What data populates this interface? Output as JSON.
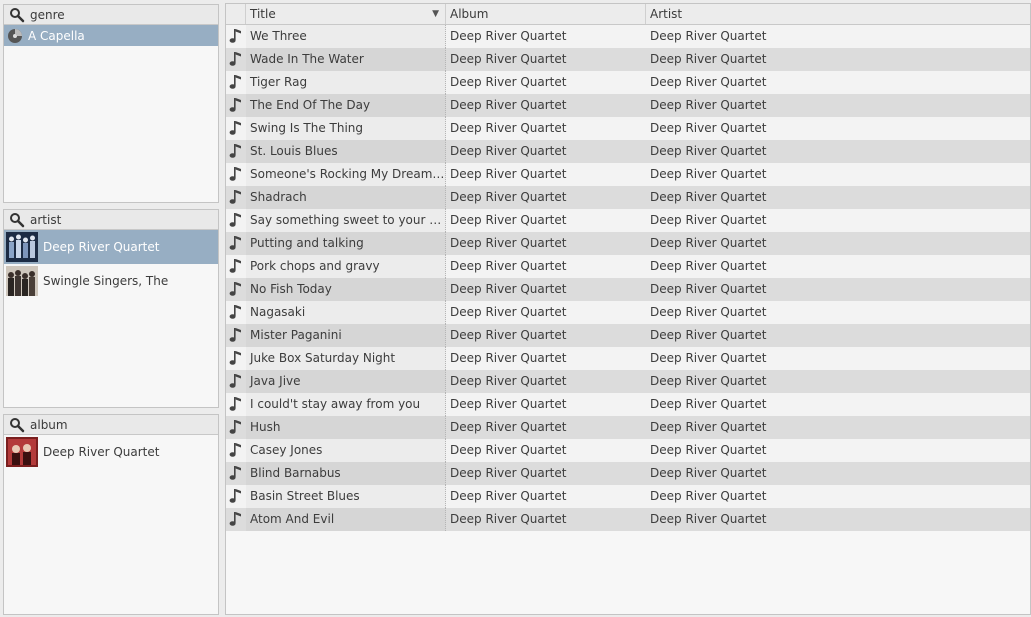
{
  "genre_pane": {
    "title": "genre",
    "items": [
      {
        "label": "A Capella",
        "selected": true
      }
    ]
  },
  "artist_pane": {
    "title": "artist",
    "items": [
      {
        "label": "Deep River Quartet",
        "selected": true
      },
      {
        "label": "Swingle Singers, The",
        "selected": false
      }
    ]
  },
  "album_pane": {
    "title": "album",
    "items": [
      {
        "label": "Deep River Quartet",
        "selected": false
      }
    ]
  },
  "tracklist": {
    "columns": {
      "title": "Title",
      "album": "Album",
      "artist": "Artist"
    },
    "sort_indicator": "▼",
    "tracks": [
      {
        "title": "We Three",
        "album": "Deep River Quartet",
        "artist": "Deep River Quartet"
      },
      {
        "title": "Wade In The Water",
        "album": "Deep River Quartet",
        "artist": "Deep River Quartet"
      },
      {
        "title": "Tiger Rag",
        "album": "Deep River Quartet",
        "artist": "Deep River Quartet"
      },
      {
        "title": "The End Of The Day",
        "album": "Deep River Quartet",
        "artist": "Deep River Quartet"
      },
      {
        "title": "Swing Is The Thing",
        "album": "Deep River Quartet",
        "artist": "Deep River Quartet"
      },
      {
        "title": "St. Louis Blues",
        "album": "Deep River Quartet",
        "artist": "Deep River Quartet"
      },
      {
        "title": "Someone's Rocking My Dreamboat",
        "album": "Deep River Quartet",
        "artist": "Deep River Quartet"
      },
      {
        "title": "Shadrach",
        "album": "Deep River Quartet",
        "artist": "Deep River Quartet"
      },
      {
        "title": "Say something sweet to your sweetheart",
        "album": "Deep River Quartet",
        "artist": "Deep River Quartet"
      },
      {
        "title": "Putting and talking",
        "album": "Deep River Quartet",
        "artist": "Deep River Quartet"
      },
      {
        "title": "Pork chops and gravy",
        "album": "Deep River Quartet",
        "artist": "Deep River Quartet"
      },
      {
        "title": "No Fish Today",
        "album": "Deep River Quartet",
        "artist": "Deep River Quartet"
      },
      {
        "title": "Nagasaki",
        "album": "Deep River Quartet",
        "artist": "Deep River Quartet"
      },
      {
        "title": "Mister Paganini",
        "album": "Deep River Quartet",
        "artist": "Deep River Quartet"
      },
      {
        "title": "Juke Box Saturday Night",
        "album": "Deep River Quartet",
        "artist": "Deep River Quartet"
      },
      {
        "title": "Java Jive",
        "album": "Deep River Quartet",
        "artist": "Deep River Quartet"
      },
      {
        "title": "I could't stay away from you",
        "album": "Deep River Quartet",
        "artist": "Deep River Quartet"
      },
      {
        "title": "Hush",
        "album": "Deep River Quartet",
        "artist": "Deep River Quartet"
      },
      {
        "title": "Casey Jones",
        "album": "Deep River Quartet",
        "artist": "Deep River Quartet"
      },
      {
        "title": "Blind Barnabus",
        "album": "Deep River Quartet",
        "artist": "Deep River Quartet"
      },
      {
        "title": "Basin Street Blues",
        "album": "Deep River Quartet",
        "artist": "Deep River Quartet"
      },
      {
        "title": "Atom And Evil",
        "album": "Deep River Quartet",
        "artist": "Deep River Quartet"
      }
    ]
  },
  "colors": {
    "selection": "#97aec3",
    "row_alt": "#dcdcdc",
    "row_base": "#f3f3f3"
  },
  "icons": {
    "search": "search-icon",
    "genre": "music-disc-icon",
    "track": "music-note-icon"
  }
}
